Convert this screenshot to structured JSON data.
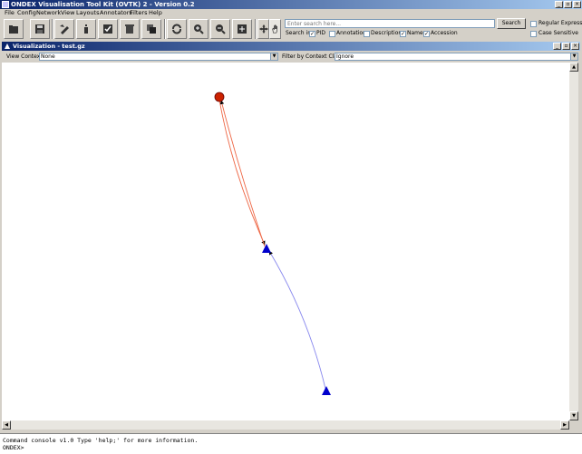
{
  "app": {
    "title": "ONDEX Visualisation Tool Kit (OVTK) 2 - Version 0.2",
    "window_controls": [
      "_",
      "▫",
      "×"
    ]
  },
  "menu": [
    "File",
    "Config",
    "Network",
    "View",
    "Layouts",
    "Annotators",
    "Filters",
    "Help"
  ],
  "toolbar": {
    "buttons": [
      "open-icon",
      "save-icon",
      "edit-icon",
      "info-icon",
      "checklist-icon",
      "delete-icon",
      "copy-icon",
      "refresh-icon",
      "zoom-in-icon",
      "zoom-out-icon",
      "fit-icon",
      "move-icon",
      "hand-icon"
    ]
  },
  "search": {
    "placeholder": "Enter search here...",
    "button_label": "Search",
    "search_in_label": "Search in:",
    "options": [
      {
        "label": "PID",
        "checked": true
      },
      {
        "label": "Annotation",
        "checked": false
      },
      {
        "label": "Description",
        "checked": false
      },
      {
        "label": "Name",
        "checked": true
      },
      {
        "label": "Accession",
        "checked": true
      }
    ],
    "regex_label": "Regular Expression",
    "regex_checked": false,
    "case_label": "Case Sensitive",
    "case_checked": false
  },
  "frame": {
    "title": "Visualization - test.gz",
    "view_context_label": "View Context:",
    "view_context_value": "None",
    "filter_label": "Filter by Context Class:",
    "filter_value": "Ignore"
  },
  "graph": {
    "node_colors": {
      "circle": "#cc2200",
      "triangle": "#0000cc"
    },
    "edge_colors": {
      "red": "#ee6644",
      "blue": "#8888ee"
    }
  },
  "console": {
    "line1": "Command console v1.0 Type 'help;' for more information.",
    "line2": "ONDEX>"
  }
}
